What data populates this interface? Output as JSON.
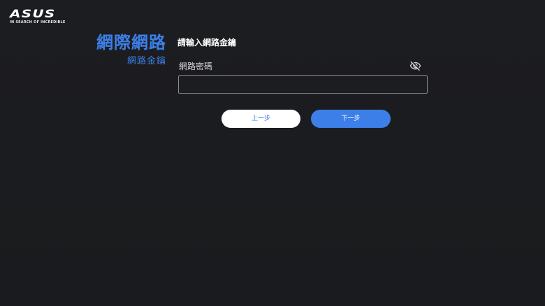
{
  "brand": {
    "logo_text": "ASUS",
    "tagline": "IN SEARCH OF INCREDIBLE"
  },
  "sidebar": {
    "title": "網際網路",
    "subtitle": "網路金鑰"
  },
  "main": {
    "heading": "請輸入網路金鑰",
    "password_field": {
      "label": "網路密碼",
      "value": "",
      "placeholder": ""
    },
    "visibility_icon": "eye-off-icon"
  },
  "buttons": {
    "back_label": "上一步",
    "next_label": "下一步"
  },
  "colors": {
    "accent": "#3d7fe8",
    "background": "#1b1c1f",
    "input_border": "#8a8b8e"
  }
}
